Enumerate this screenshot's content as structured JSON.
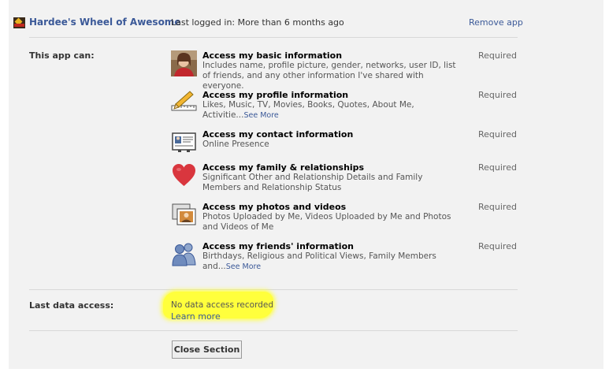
{
  "app": {
    "title": "Hardee's Wheel of Awesome",
    "last_logged": "Last logged in: More than 6 months ago",
    "remove_label": "Remove app"
  },
  "permissions": {
    "label": "This app can:",
    "items": [
      {
        "icon": "profile-photo-icon",
        "title": "Access my basic information",
        "desc": "Includes name, profile picture, gender, networks, user ID, list of friends, and any other information I've shared with everyone.",
        "required": "Required"
      },
      {
        "icon": "pencil-ruler-icon",
        "title": "Access my profile information",
        "desc": "Likes, Music, TV, Movies, Books, Quotes, About Me, Activitie...",
        "see_more": "See More",
        "required": "Required"
      },
      {
        "icon": "contact-card-icon",
        "title": "Access my contact information",
        "desc": "Online Presence",
        "required": "Required"
      },
      {
        "icon": "heart-icon",
        "title": "Access my family & relationships",
        "desc": "Significant Other and Relationship Details and Family Members and Relationship Status",
        "required": "Required"
      },
      {
        "icon": "photos-icon",
        "title": "Access my photos and videos",
        "desc": "Photos Uploaded by Me, Videos Uploaded by Me and Photos and Videos of Me",
        "required": "Required"
      },
      {
        "icon": "friends-icon",
        "title": "Access my friends' information",
        "desc": "Birthdays, Religious and Political Views, Family Members and...",
        "see_more": "See More",
        "required": "Required"
      }
    ]
  },
  "data_access": {
    "label": "Last data access:",
    "value": "No data access recorded",
    "learn_more": "Learn more",
    "highlight_color": "#ffff3c"
  },
  "close_button": "Close Section",
  "colors": {
    "link": "#3b5998",
    "panel_bg": "#f2f2f2",
    "heart": "#d9363e"
  }
}
